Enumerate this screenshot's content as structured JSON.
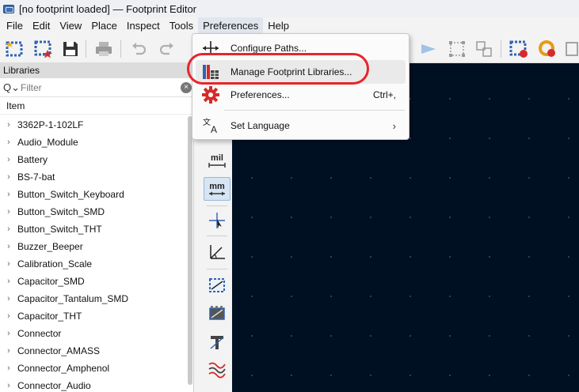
{
  "window": {
    "title": "[no footprint loaded] — Footprint Editor"
  },
  "menubar": {
    "items": [
      "File",
      "Edit",
      "View",
      "Place",
      "Inspect",
      "Tools",
      "Preferences",
      "Help"
    ],
    "open_item": "Preferences"
  },
  "libraries_panel": {
    "header": "Libraries",
    "filter_placeholder": "Filter",
    "column_header": "Item",
    "items": [
      "3362P-1-102LF",
      "Audio_Module",
      "Battery",
      "BS-7-bat",
      "Button_Switch_Keyboard",
      "Button_Switch_SMD",
      "Button_Switch_THT",
      "Buzzer_Beeper",
      "Calibration_Scale",
      "Capacitor_SMD",
      "Capacitor_Tantalum_SMD",
      "Capacitor_THT",
      "Connector",
      "Connector_AMASS",
      "Connector_Amphenol",
      "Connector_Audio"
    ]
  },
  "tool_strip": {
    "mil_label": "mil",
    "mm_label": "mm"
  },
  "preferences_menu": {
    "items": [
      {
        "label": "Configure Paths...",
        "icon": "configure-paths-icon",
        "shortcut": ""
      },
      {
        "label": "Manage Footprint Libraries...",
        "icon": "library-table-icon",
        "shortcut": ""
      },
      {
        "label": "Preferences...",
        "icon": "gear-icon",
        "shortcut": "Ctrl+,"
      },
      {
        "label": "Set Language",
        "icon": "language-icon",
        "shortcut": "",
        "submenu_arrow": "›"
      }
    ]
  },
  "colors": {
    "canvas_background": "#001023",
    "highlight_ring": "#e8242c",
    "accent_blue": "#3d6fb0",
    "gear_red": "#d62a2a"
  }
}
